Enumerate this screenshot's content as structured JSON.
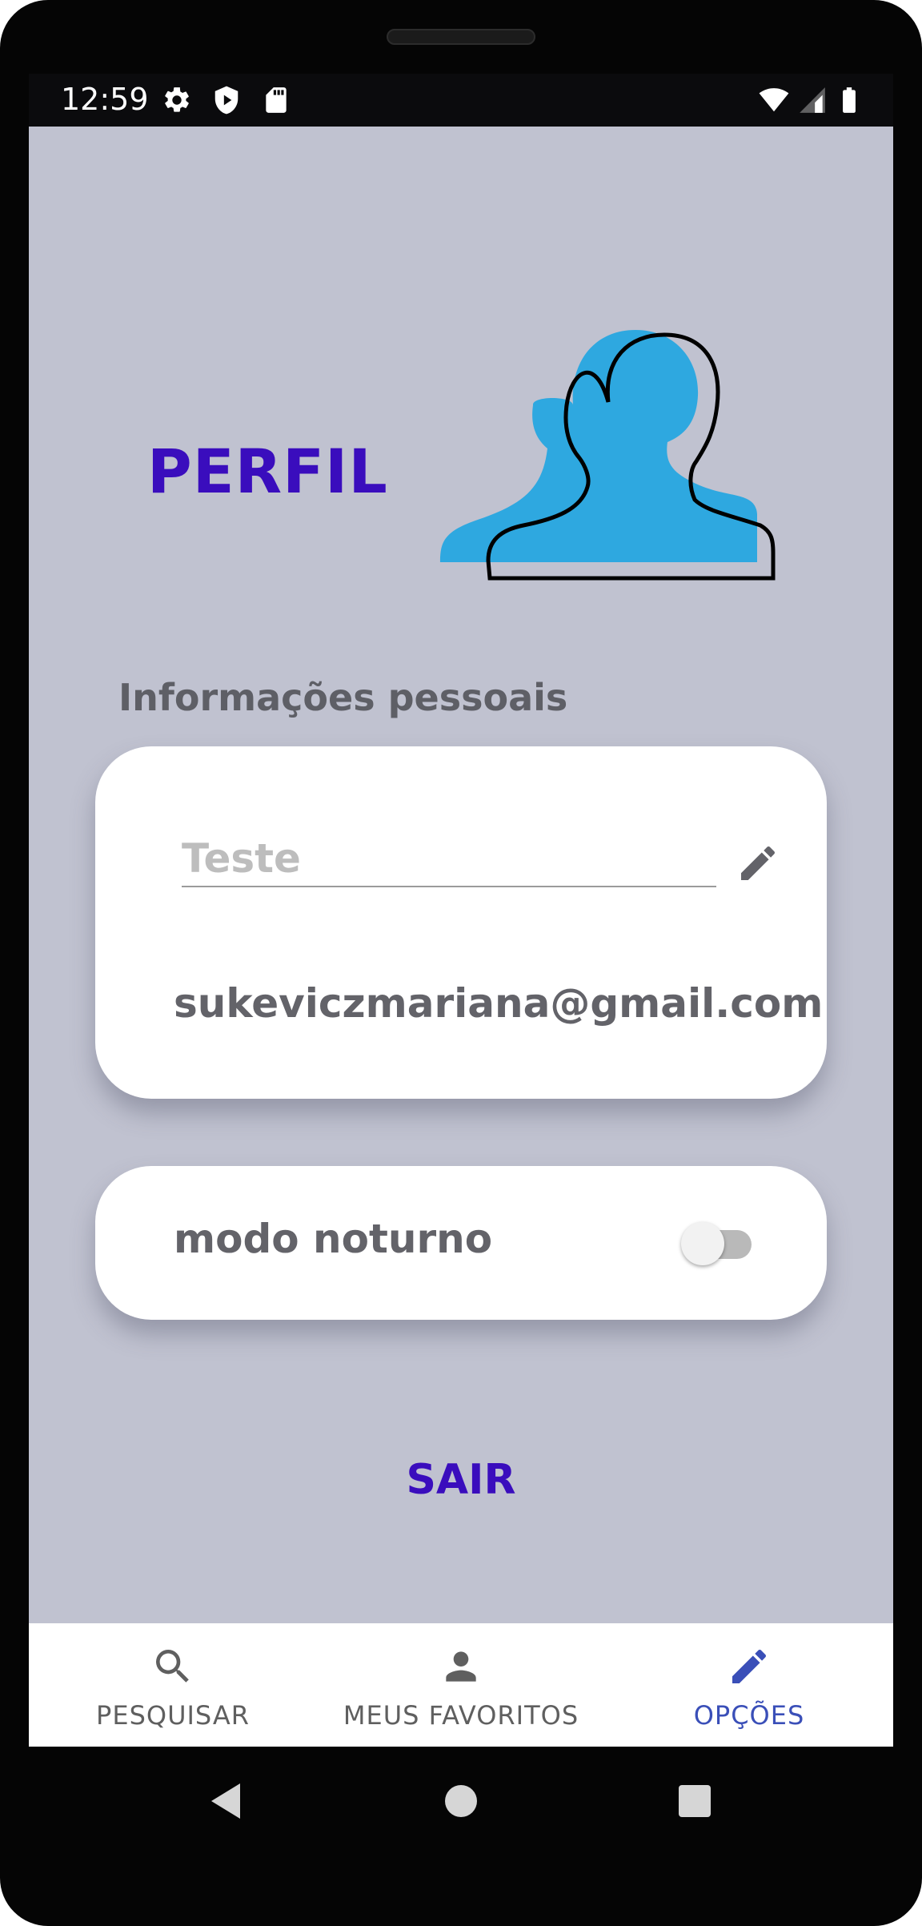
{
  "status_bar": {
    "time": "12:59",
    "left_icons": [
      "gear-icon",
      "shield-play-icon",
      "sd-card-icon"
    ],
    "right_icons": [
      "wifi-icon",
      "cellular-signal-icon",
      "battery-icon"
    ]
  },
  "profile": {
    "title": "PERFIL",
    "avatar": "person-silhouette-icon",
    "title_color": "#3a0dbd",
    "avatar_color": "#2ea8e0"
  },
  "personal_info": {
    "section_title": "Informações pessoais",
    "name_placeholder": "Teste",
    "name_value": "",
    "email": "sukeviczmariana@gmail.com",
    "edit_icon": "pencil-icon"
  },
  "night_mode": {
    "label": "modo noturno",
    "enabled": false
  },
  "logout": {
    "label": "SAIR"
  },
  "bottom_nav": {
    "items": [
      {
        "label": "PESQUISAR",
        "icon": "search-icon",
        "active": false
      },
      {
        "label": "MEUS FAVORITOS",
        "icon": "person-icon",
        "active": false
      },
      {
        "label": "OPÇÕES",
        "icon": "pencil-icon",
        "active": true
      }
    ],
    "active_color": "#3a4fb8"
  },
  "system_nav": {
    "buttons": [
      "back-icon",
      "home-icon",
      "recents-icon"
    ]
  },
  "colors": {
    "background": "#c0c2d0",
    "card": "#ffffff"
  }
}
